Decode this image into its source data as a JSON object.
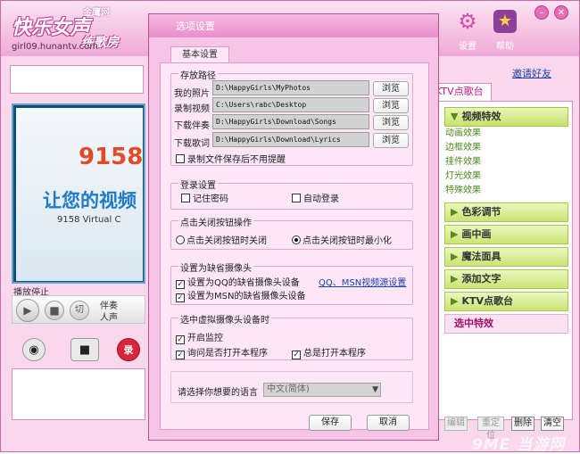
{
  "app": {
    "logo_brand": "金鹰网",
    "logo_main": "快乐女声",
    "logo_sub": "练歌房",
    "logo_url": "girl09.hunantv.com"
  },
  "toolbar": {
    "settings_label": "设置",
    "help_label": "帮助"
  },
  "invite_label": "邀请好友",
  "ktv_tab_label": "KTV点歌台",
  "right_panel": {
    "video_effects_label": "视频特效",
    "video_effects_items": [
      "动画效果",
      "边框效果",
      "挂件效果",
      "灯光效果",
      "特殊效果"
    ],
    "sections": [
      "色彩调节",
      "画中画",
      "魔法面具",
      "添加文字",
      "KTV点歌台"
    ],
    "selected_label": "选中特效",
    "buttons": [
      "编辑",
      "重定位",
      "删除",
      "清空"
    ]
  },
  "video": {
    "logo": "9158",
    "slogan": "让您的视频",
    "caption": "9158 Virtual C"
  },
  "player": {
    "status": "播放停止",
    "accompaniment_label": "伴奏",
    "voice_label": "人声",
    "cut_label": "切"
  },
  "record_label": "录",
  "dialog": {
    "title": "选项设置",
    "tab": "基本设置",
    "storage": {
      "title": "存放路径",
      "rows": [
        {
          "label": "我的照片",
          "value": "D:\\HappyGirls\\MyPhotos",
          "button": "浏览"
        },
        {
          "label": "录制视频",
          "value": "C:\\Users\\rabc\\Desktop",
          "button": "浏览"
        },
        {
          "label": "下载伴奏",
          "value": "D:\\HappyGirls\\Download\\Songs",
          "button": "浏览"
        },
        {
          "label": "下载歌词",
          "value": "D:\\HappyGirls\\Download\\Lyrics",
          "button": "浏览"
        }
      ],
      "no_prompt_label": "录制文件保存后不用提醒"
    },
    "login": {
      "title": "登录设置",
      "remember_password": "记住密码",
      "auto_login": "自动登录"
    },
    "close_action": {
      "title": "点击关闭按钮操作",
      "close_option": "点击关闭按钮时关闭",
      "minimize_option": "点击关闭按钮时最小化"
    },
    "default_camera": {
      "title": "设置为缺省摄像头",
      "qq_label": "设置为QQ的缺省摄像头设备",
      "msn_label": "设置为MSN的缺省摄像头设备",
      "link": "QQ、MSN视频源设置"
    },
    "virtual_camera": {
      "title": "选中虚拟摄像头设备时",
      "start_monitor": "开启监控",
      "ask_open": "询问是否打开本程序",
      "always_open": "总是打开本程序"
    },
    "language": {
      "label": "请选择你想要的语言",
      "value": "中文(简体)"
    },
    "save_label": "保存",
    "cancel_label": "取消"
  },
  "watermark": "9ME 当游网"
}
